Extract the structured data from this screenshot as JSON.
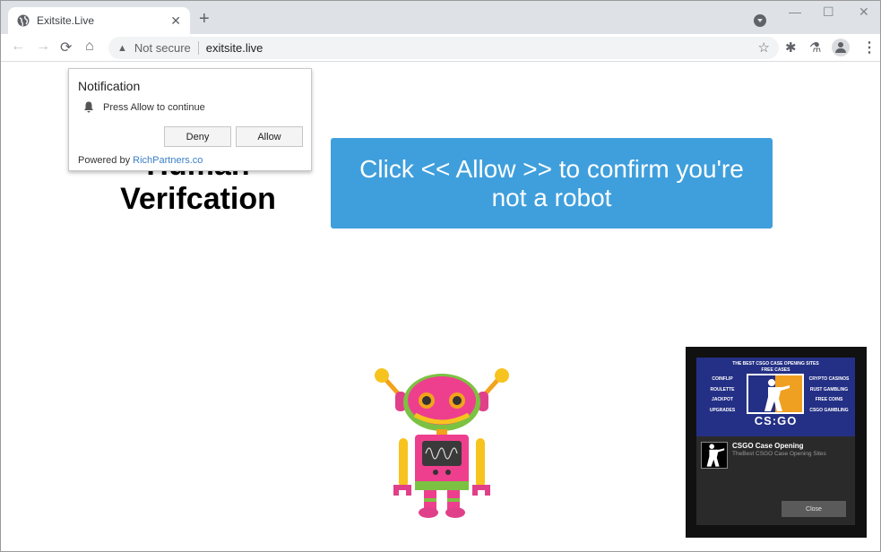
{
  "browser": {
    "tab_title": "Exitsite.Live",
    "tab_close": "✕",
    "new_tab": "+",
    "window_controls": {
      "minimize": "—",
      "maximize": "☐",
      "close": "✕"
    },
    "nav": {
      "back": "←",
      "forward": "→",
      "reload": "⟳",
      "home": "⌂"
    },
    "security_warning": "▲",
    "not_secure_label": "Not secure",
    "url": "exitsite.live",
    "star": "☆",
    "extensions_icon": "✱",
    "labs_icon": "⚗",
    "menu": "⋮"
  },
  "page": {
    "heading": "Human Verifcation",
    "cta": "Click << Allow >> to confirm you're not a robot"
  },
  "notification": {
    "title": "Notification",
    "bell": "🔔",
    "message": "Press Allow to continue",
    "deny_label": "Deny",
    "allow_label": "Allow",
    "powered_by": "Powered by ",
    "powered_link": "RichPartners.co"
  },
  "ad": {
    "banner_title": "THE BEST CSGO CASE OPENING SITES",
    "banner_sub": "FREE CASES",
    "left_items": [
      "COINFLIP",
      "ROULETTE",
      "JACKPOT",
      "UPGRADES"
    ],
    "right_items": [
      "CRYPTO CASINOS",
      "RUST GAMBLING",
      "FREE COINS",
      "CSGO GAMBLING"
    ],
    "logo_text": "CS:GO",
    "title": "CSGO Case Opening",
    "description": "TheBest CSGO Case Opening Sites",
    "close_label": "Close"
  },
  "colors": {
    "cta_bg": "#3f9fdc",
    "link": "#3a7fc8",
    "ad_banner": "#243085",
    "ad_orange": "#f0a020"
  }
}
